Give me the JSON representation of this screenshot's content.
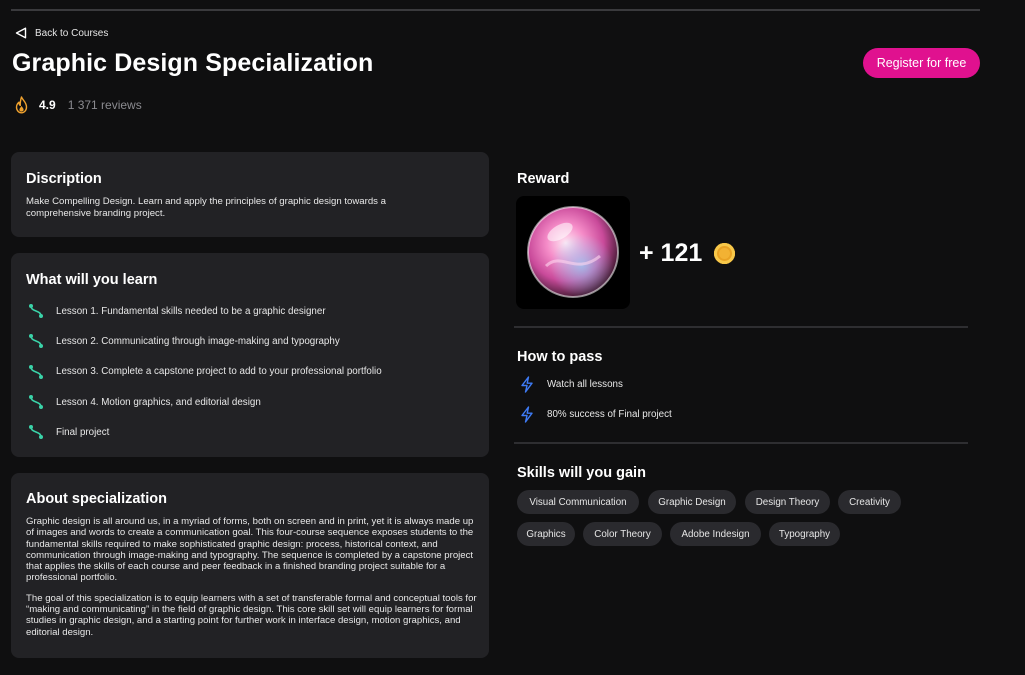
{
  "nav": {
    "back_label": "Back to Courses"
  },
  "course": {
    "title": "Graphic Design Specialization",
    "rating": "4.9",
    "reviews": "1 371 reviews",
    "register_label": "Register for free"
  },
  "description": {
    "heading": "Discription",
    "text": "Make Compelling Design. Learn and apply the principles of graphic design towards a comprehensive branding project."
  },
  "learn": {
    "heading": "What will you learn",
    "lessons": [
      "Lesson 1. Fundamental skills needed to be a graphic designer",
      "Lesson 2. Communicating through image-making and typography",
      "Lesson 3. Complete a capstone project to add to your professional portfolio",
      "Lesson 4. Motion graphics, and editorial design",
      "Final project"
    ]
  },
  "about": {
    "heading": "About specialization",
    "paragraphs": [
      "Graphic design is all around us, in a myriad of forms, both on screen and in print, yet it is always made up of images and words to create a communication goal. This four-course sequence exposes students to the fundamental skills required to make sophisticated graphic design: process, historical context, and communication through image-making and typography. The sequence is completed by a capstone project that applies the skills of each course and peer feedback in a finished branding project suitable for a professional portfolio.",
      "The goal of this specialization is to equip learners with a set of transferable formal and conceptual tools for “making and communicating” in the field of graphic design. This core skill set will equip learners for formal studies in graphic design, and a starting point for further work in interface design, motion graphics, and editorial design."
    ]
  },
  "reward": {
    "heading": "Reward",
    "amount": "+ 121"
  },
  "how_to_pass": {
    "heading": "How to pass",
    "items": [
      "Watch all lessons",
      "80% success of Final project"
    ]
  },
  "skills": {
    "heading": "Skills will you gain",
    "tags": [
      "Visual Communication",
      "Graphic Design",
      "Design Theory",
      "Creativity",
      "Graphics",
      "Color Theory",
      "Adobe Indesign",
      "Typography"
    ]
  },
  "colors": {
    "accent": "#e0118f",
    "lesson_icon": "#3ad3a8",
    "pass_icon": "#3e7bf5",
    "coin": "#f2b233",
    "card_bg": "#222225"
  },
  "icons": {
    "back": "back-triangle-icon",
    "rating": "fire-icon",
    "lesson": "lesson-path-icon",
    "pass": "lightning-icon",
    "coin": "coin-icon"
  }
}
